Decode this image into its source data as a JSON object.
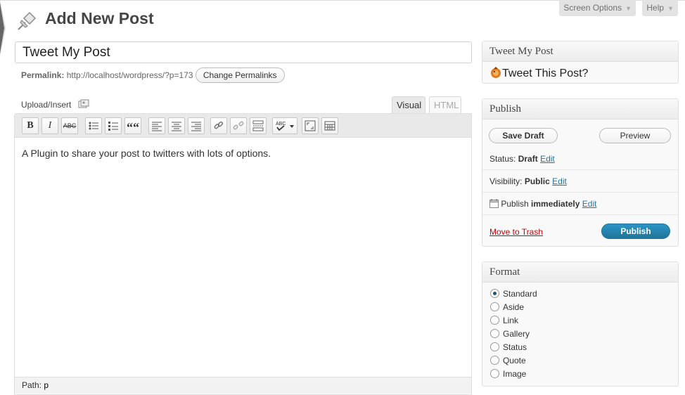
{
  "header": {
    "title": "Add New Post",
    "screen_options_label": "Screen Options",
    "help_label": "Help"
  },
  "post": {
    "title_value": "Tweet My Post",
    "permalink_label": "Permalink:",
    "permalink_url": "http://localhost/wordpress/?p=173",
    "change_permalinks_label": "Change Permalinks"
  },
  "editor": {
    "upload_insert_label": "Upload/Insert",
    "tab_visual": "Visual",
    "tab_html": "HTML",
    "toolbar_icons": [
      "bold-icon",
      "italic-icon",
      "strikethrough-icon",
      "bullet-list-icon",
      "numbered-list-icon",
      "blockquote-icon",
      "align-left-icon",
      "align-center-icon",
      "align-right-icon",
      "link-icon",
      "unlink-icon",
      "more-tag-icon",
      "spellcheck-icon",
      "fullscreen-icon",
      "kitchen-sink-icon"
    ],
    "bold_glyph": "B",
    "italic_glyph": "I",
    "strike_glyph": "ABC",
    "quote_glyph": "““",
    "content": "A Plugin to share your post to twitters with lots of options.",
    "path_label": "Path:",
    "path_value": "p"
  },
  "tweet_box": {
    "title": "Tweet My Post",
    "checkbox_label": "Tweet This Post?"
  },
  "publish_box": {
    "title": "Publish",
    "save_draft_label": "Save Draft",
    "preview_label": "Preview",
    "status_label": "Status:",
    "status_value": "Draft",
    "visibility_label": "Visibility:",
    "visibility_value": "Public",
    "publish_label": "Publish",
    "publish_when": "immediately",
    "edit_label": "Edit",
    "trash_label": "Move to Trash",
    "publish_button_label": "Publish"
  },
  "format_box": {
    "title": "Format",
    "options": [
      "Standard",
      "Aside",
      "Link",
      "Gallery",
      "Status",
      "Quote",
      "Image"
    ],
    "selected": "Standard"
  },
  "colors": {
    "link": "#21759b",
    "primary": "#21759b",
    "trash": "#bc0b0b"
  }
}
